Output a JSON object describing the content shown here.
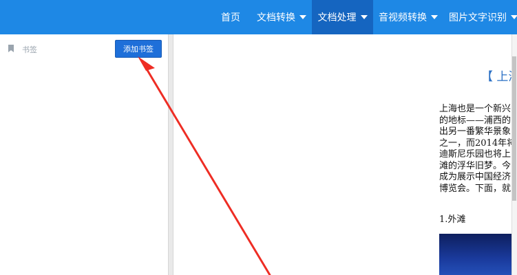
{
  "nav": {
    "home": "首页",
    "doc_convert": "文档转换",
    "doc_process": "文档处理",
    "av_convert": "音视频转换",
    "ocr": "图片文字识别"
  },
  "sidebar": {
    "bookmark_label": "书签",
    "add_bookmark_button": "添加书签"
  },
  "document": {
    "title": "【 上海",
    "paragraph_lines": [
      "上海也是一个新兴",
      "的地标——浦西的",
      "出另一番繁华景象",
      "之一，而2014年将",
      "迪斯尼乐园也将上",
      "滩的浮华旧梦。今",
      "成为展示中国经济",
      "博览会。下面，就"
    ],
    "section_heading": "1.外滩"
  },
  "colors": {
    "nav_bg": "#1e88e5",
    "nav_active_bg": "#1565c0",
    "button_bg": "#1e6fd9",
    "annotation_arrow": "#ee2d24",
    "title_blue": "#2a6fc4"
  }
}
